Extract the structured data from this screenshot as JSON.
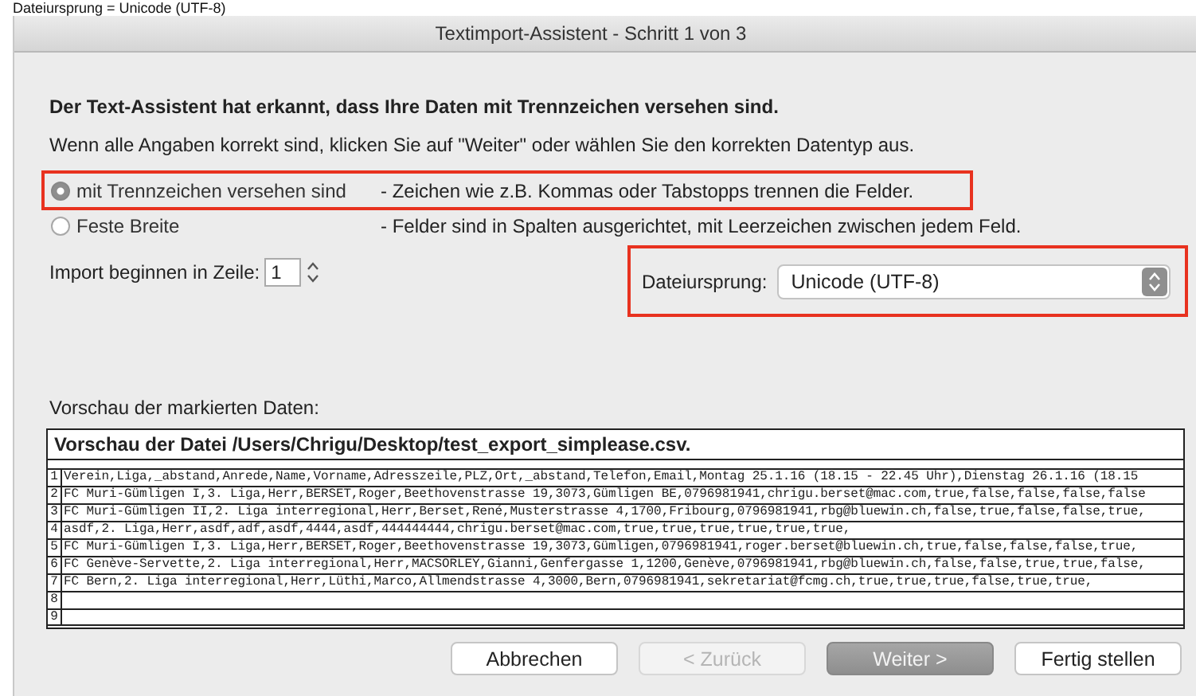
{
  "caption": "Dateiursprung = Unicode (UTF-8)",
  "window": {
    "title": "Textimport-Assistent - Schritt 1 von 3"
  },
  "heading": "Der Text-Assistent hat erkannt, dass Ihre Daten mit Trennzeichen versehen sind.",
  "instruction": "Wenn alle Angaben korrekt sind, klicken Sie auf \"Weiter\" oder wählen Sie den korrekten Datentyp aus.",
  "data_types": [
    {
      "label": "mit Trennzeichen versehen sind",
      "description": "- Zeichen wie z.B. Kommas oder Tabstopps trennen die Felder.",
      "selected": true,
      "highlighted": true
    },
    {
      "label": "Feste Breite",
      "description": "- Felder sind in Spalten ausgerichtet, mit Leerzeichen zwischen jedem Feld.",
      "selected": false,
      "highlighted": false
    }
  ],
  "start_row": {
    "label": "Import beginnen in Zeile:",
    "value": "1"
  },
  "file_origin": {
    "label": "Dateiursprung:",
    "value": "Unicode (UTF-8)",
    "highlighted": true
  },
  "preview": {
    "label": "Vorschau der markierten Daten:",
    "title": "Vorschau der Datei /Users/Chrigu/Desktop/test_export_simplease.csv.",
    "rows": [
      {
        "number": "1",
        "text": "Verein,Liga,_abstand,Anrede,Name,Vorname,Adresszeile,PLZ,Ort,_abstand,Telefon,Email,Montag 25.1.16 (18.15 - 22.45 Uhr),Dienstag 26.1.16 (18.15"
      },
      {
        "number": "2",
        "text": "FC Muri-Gümligen I,3. Liga,Herr,BERSET,Roger,Beethovenstrasse 19,3073,Gümligen BE,0796981941,chrigu.berset@mac.com,true,false,false,false,false"
      },
      {
        "number": "3",
        "text": "FC Muri-Gümligen II,2. Liga interregional,Herr,Berset,René,Musterstrasse 4,1700,Fribourg,0796981941,rbg@bluewin.ch,false,true,false,false,true,"
      },
      {
        "number": "4",
        "text": "asdf,2. Liga,Herr,asdf,adf,asdf,4444,asdf,444444444,chrigu.berset@mac.com,true,true,true,true,true,true,"
      },
      {
        "number": "5",
        "text": "FC Muri-Gümligen I,3. Liga,Herr,BERSET,Roger,Beethovenstrasse 19,3073,Gümligen,0796981941,roger.berset@bluewin.ch,true,false,false,false,true,"
      },
      {
        "number": "6",
        "text": "FC Genève-Servette,2. Liga interregional,Herr,MACSORLEY,Gianni,Genfergasse 1,1200,Genève,0796981941,rbg@bluewin.ch,false,false,true,true,false,"
      },
      {
        "number": "7",
        "text": "FC Bern,2. Liga interregional,Herr,Lüthi,Marco,Allmendstrasse 4,3000,Bern,0796981941,sekretariat@fcmg.ch,true,true,true,false,true,true,"
      },
      {
        "number": "8",
        "text": ""
      },
      {
        "number": "9",
        "text": ""
      }
    ]
  },
  "buttons": [
    {
      "label": "Abbrechen",
      "disabled": false,
      "default": false
    },
    {
      "label": "< Zurück",
      "disabled": true,
      "default": false
    },
    {
      "label": "Weiter >",
      "disabled": false,
      "default": true
    },
    {
      "label": "Fertig stellen",
      "disabled": false,
      "default": false
    }
  ]
}
